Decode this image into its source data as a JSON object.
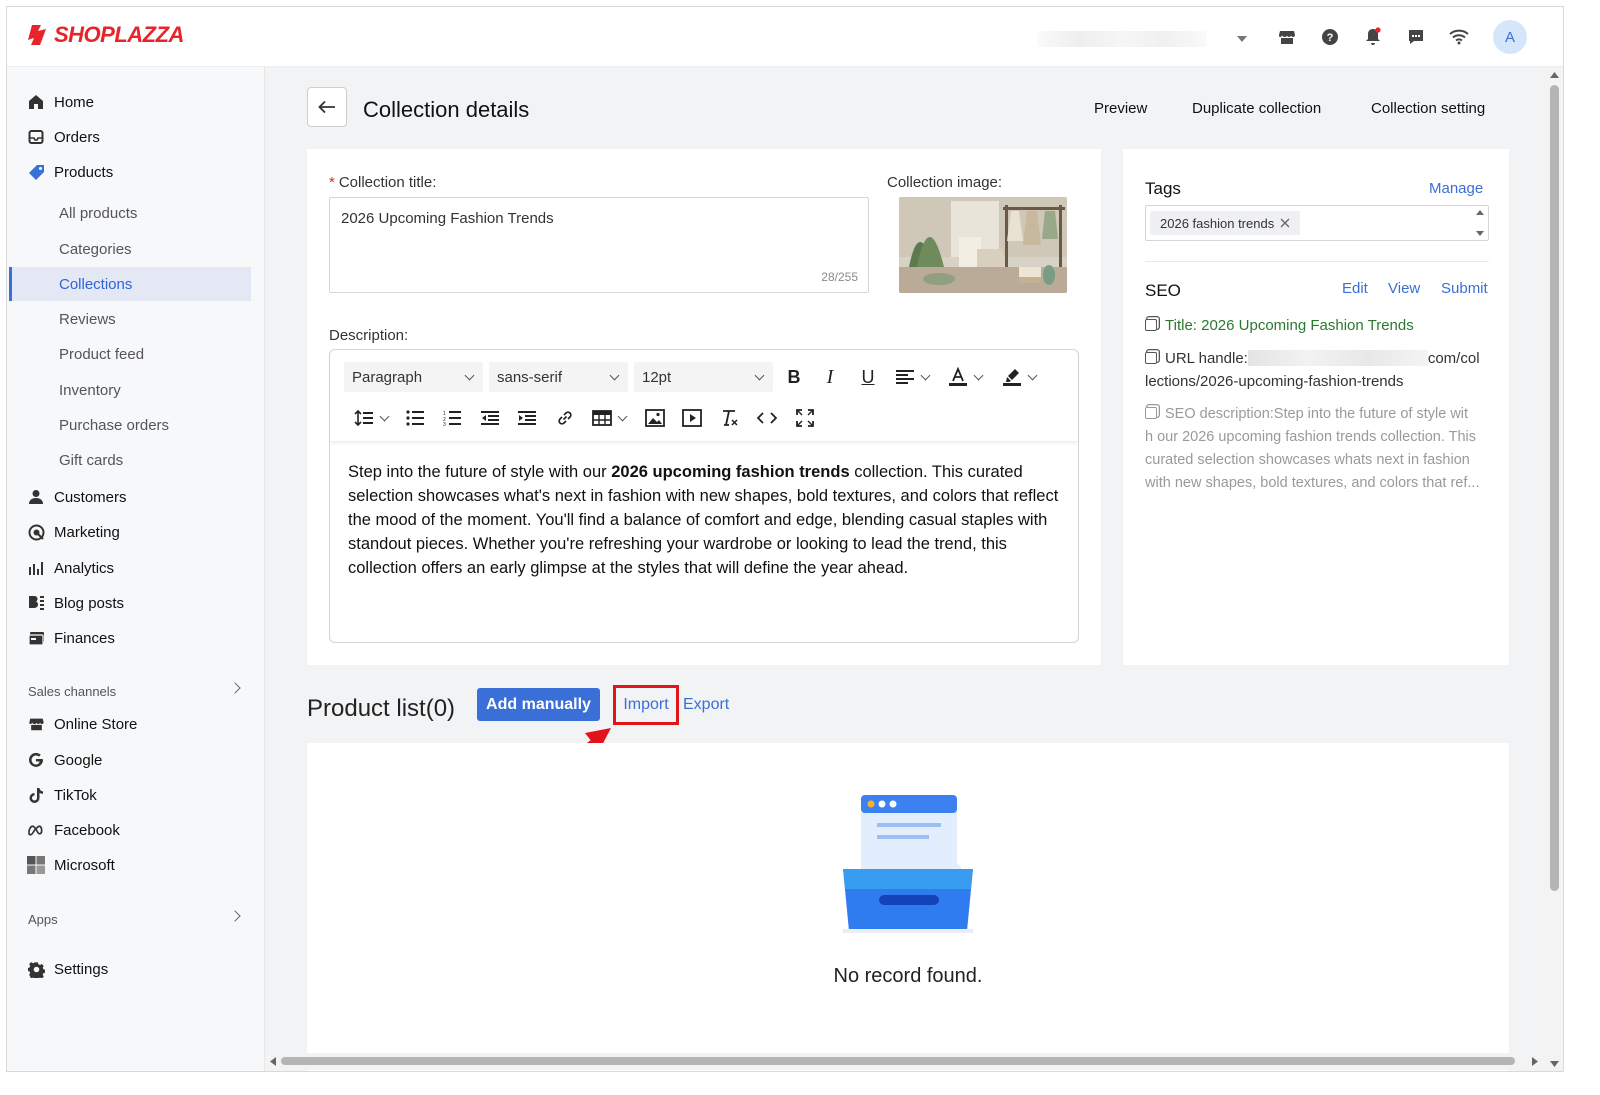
{
  "app": {
    "brand": "SHOPLAZZA",
    "brand_color": "#e8242b",
    "accent_color": "#3a6fd8"
  },
  "topbar": {
    "avatar_initial": "A",
    "icons": [
      "store-icon",
      "help-icon",
      "bell-icon",
      "chat-icon",
      "wifi-icon"
    ]
  },
  "sidebar": {
    "main_items": [
      {
        "label": "Home",
        "icon": "home-icon"
      },
      {
        "label": "Orders",
        "icon": "inbox-icon"
      },
      {
        "label": "Products",
        "icon": "tag-icon"
      }
    ],
    "product_subitems": [
      "All products",
      "Categories",
      "Collections",
      "Reviews",
      "Product feed",
      "Inventory",
      "Purchase orders",
      "Gift cards"
    ],
    "active_subitem": "Collections",
    "more_items": [
      {
        "label": "Customers",
        "icon": "user-icon"
      },
      {
        "label": "Marketing",
        "icon": "marketing-icon"
      },
      {
        "label": "Analytics",
        "icon": "analytics-icon"
      },
      {
        "label": "Blog posts",
        "icon": "blog-icon"
      },
      {
        "label": "Finances",
        "icon": "finance-icon"
      }
    ],
    "sales_channels_label": "Sales channels",
    "channels": [
      {
        "label": "Online Store",
        "icon": "store-icon"
      },
      {
        "label": "Google",
        "icon": "google-icon"
      },
      {
        "label": "TikTok",
        "icon": "tiktok-icon"
      },
      {
        "label": "Facebook",
        "icon": "meta-icon"
      },
      {
        "label": "Microsoft",
        "icon": "microsoft-icon"
      }
    ],
    "apps_label": "Apps",
    "settings_label": "Settings"
  },
  "header": {
    "title": "Collection details",
    "actions": [
      "Preview",
      "Duplicate collection",
      "Collection setting"
    ]
  },
  "form": {
    "title_label": "Collection title:",
    "title_value": "2026 Upcoming Fashion Trends",
    "title_count": "28/255",
    "image_label": "Collection image:",
    "description_label": "Description:",
    "toolbar": {
      "paragraph": "Paragraph",
      "font": "sans-serif",
      "size": "12pt"
    },
    "description": {
      "before": "Step into the future of style with our ",
      "bold": "2026 upcoming fashion trends",
      "after": " collection. This curated selection showcases what's next in fashion with new shapes, bold textures, and colors that reflect the mood of the moment. You'll find a balance of comfort and edge, blending casual staples with standout pieces. Whether you're refreshing your wardrobe or looking to lead the trend, this collection offers an early glimpse at the styles that will define the year ahead."
    }
  },
  "tags": {
    "title": "Tags",
    "manage": "Manage",
    "items": [
      "2026 fashion trends"
    ]
  },
  "seo": {
    "title": "SEO",
    "edit": "Edit",
    "view": "View",
    "submit": "Submit",
    "seo_title": "Title: 2026 Upcoming Fashion Trends",
    "url_label": "URL handle:",
    "url_tail": "com/col",
    "url_path": "lections/2026-upcoming-fashion-trends",
    "description_lines": [
      "SEO description:Step into the future of style wit",
      "h our 2026 upcoming fashion trends collection. This",
      "curated selection showcases whats next in fashion",
      "with new shapes, bold textures, and colors that ref..."
    ]
  },
  "product_list": {
    "title": "Product list(0)",
    "add_manually": "Add manually",
    "import": "Import",
    "export": "Export",
    "empty_text": "No record found."
  }
}
